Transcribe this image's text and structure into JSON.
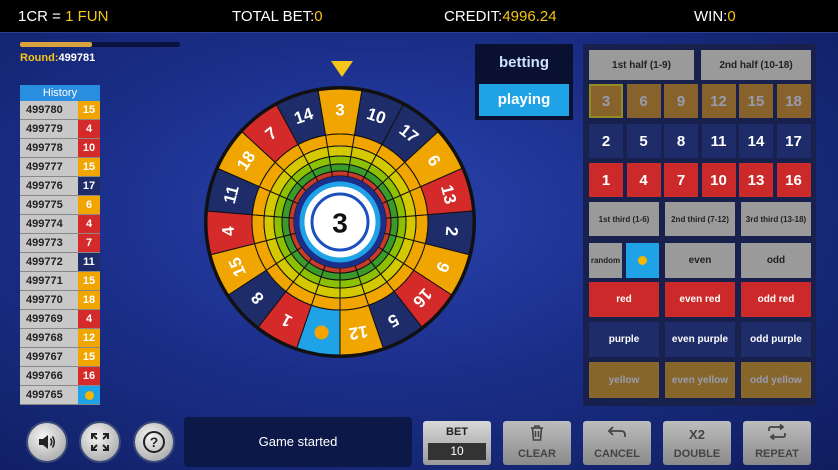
{
  "topbar": {
    "rate_label": "1CR = ",
    "rate_value": "1 FUN",
    "total_bet_label": "TOTAL BET:",
    "total_bet_value": "0",
    "credit_label": "CREDIT:",
    "credit_value": "4996.24",
    "win_label": "WIN:",
    "win_value": "0"
  },
  "round": {
    "label": "Round:",
    "value": "499781",
    "progress": 0.45
  },
  "history": {
    "title": "History",
    "rows": [
      {
        "id": "499780",
        "num": "15",
        "color": "#f0a500"
      },
      {
        "id": "499779",
        "num": "4",
        "color": "#d42a2a"
      },
      {
        "id": "499778",
        "num": "10",
        "color": "#d42a2a"
      },
      {
        "id": "499777",
        "num": "15",
        "color": "#f0a500"
      },
      {
        "id": "499776",
        "num": "17",
        "color": "#1e2d6a"
      },
      {
        "id": "499775",
        "num": "6",
        "color": "#f0a500"
      },
      {
        "id": "499774",
        "num": "4",
        "color": "#d42a2a"
      },
      {
        "id": "499773",
        "num": "7",
        "color": "#d42a2a"
      },
      {
        "id": "499772",
        "num": "11",
        "color": "#1e2d6a"
      },
      {
        "id": "499771",
        "num": "15",
        "color": "#f0a500"
      },
      {
        "id": "499770",
        "num": "18",
        "color": "#f0a500"
      },
      {
        "id": "499769",
        "num": "4",
        "color": "#d42a2a"
      },
      {
        "id": "499768",
        "num": "12",
        "color": "#f0a500"
      },
      {
        "id": "499767",
        "num": "15",
        "color": "#f0a500"
      },
      {
        "id": "499766",
        "num": "16",
        "color": "#d42a2a"
      },
      {
        "id": "499765",
        "num": "",
        "color": "#1fa3e6",
        "dot": true
      }
    ]
  },
  "wheel": {
    "result": "3",
    "segments": [
      {
        "num": "3",
        "color": "#f0a500"
      },
      {
        "num": "10",
        "color": "#1e2d6a"
      },
      {
        "num": "17",
        "color": "#1e2d6a"
      },
      {
        "num": "6",
        "color": "#f0a500"
      },
      {
        "num": "13",
        "color": "#d42a2a"
      },
      {
        "num": "2",
        "color": "#1e2d6a"
      },
      {
        "num": "9",
        "color": "#f0a500"
      },
      {
        "num": "16",
        "color": "#d42a2a"
      },
      {
        "num": "5",
        "color": "#1e2d6a"
      },
      {
        "num": "12",
        "color": "#f0a500"
      },
      {
        "num": "",
        "color": "#1fa3e6",
        "dot": true
      },
      {
        "num": "1",
        "color": "#d42a2a"
      },
      {
        "num": "8",
        "color": "#1e2d6a"
      },
      {
        "num": "15",
        "color": "#f0a500"
      },
      {
        "num": "4",
        "color": "#d42a2a"
      },
      {
        "num": "11",
        "color": "#1e2d6a"
      },
      {
        "num": "18",
        "color": "#f0a500"
      },
      {
        "num": "7",
        "color": "#d42a2a"
      },
      {
        "num": "14",
        "color": "#1e2d6a"
      }
    ]
  },
  "mode": {
    "betting": "betting",
    "playing": "playing"
  },
  "grid": {
    "first_half": "1st half (1-9)",
    "second_half": "2nd half (10-18)",
    "row1": [
      "3",
      "6",
      "9",
      "12",
      "15",
      "18"
    ],
    "row2": [
      "2",
      "5",
      "8",
      "11",
      "14",
      "17"
    ],
    "row3": [
      "1",
      "4",
      "7",
      "10",
      "13",
      "16"
    ],
    "first_third": "1st third (1-6)",
    "second_third": "2nd third (7-12)",
    "third_third": "3rd third (13-18)",
    "random": "random",
    "even": "even",
    "odd": "odd",
    "red": "red",
    "even_red": "even red",
    "odd_red": "odd red",
    "purple": "purple",
    "even_purple": "even purple",
    "odd_purple": "odd purple",
    "yellow": "yellow",
    "even_yellow": "even yellow",
    "odd_yellow": "odd yellow"
  },
  "status": {
    "message": "Game started"
  },
  "bet": {
    "label": "BET",
    "value": "10"
  },
  "actions": {
    "clear": "CLEAR",
    "cancel": "CANCEL",
    "double_icon": "X2",
    "double": "DOUBLE",
    "repeat": "REPEAT"
  },
  "icons": [
    "speaker-icon",
    "fullscreen-icon",
    "help-icon",
    "trash-icon",
    "undo-icon",
    "repeat-icon"
  ]
}
